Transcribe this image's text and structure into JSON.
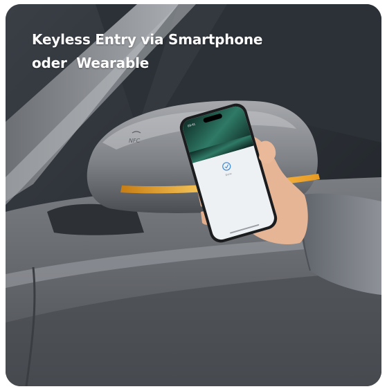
{
  "headline": {
    "line1": "Keyless Entry via Smartphone",
    "line2": "oder  Wearable"
  },
  "mirror": {
    "badge": "NFC"
  },
  "phone": {
    "status_time": "09:41",
    "check_icon": "checkmark-circle-icon",
    "confirm_label": "Done"
  },
  "colors": {
    "car_paint": "#8a8d91",
    "window_dark": "#2a2e33",
    "indicator_amber": "#f2b233",
    "sleeve": "#7b7f86",
    "skin": "#e8b89a",
    "screen_green": "#1f5c4e"
  }
}
